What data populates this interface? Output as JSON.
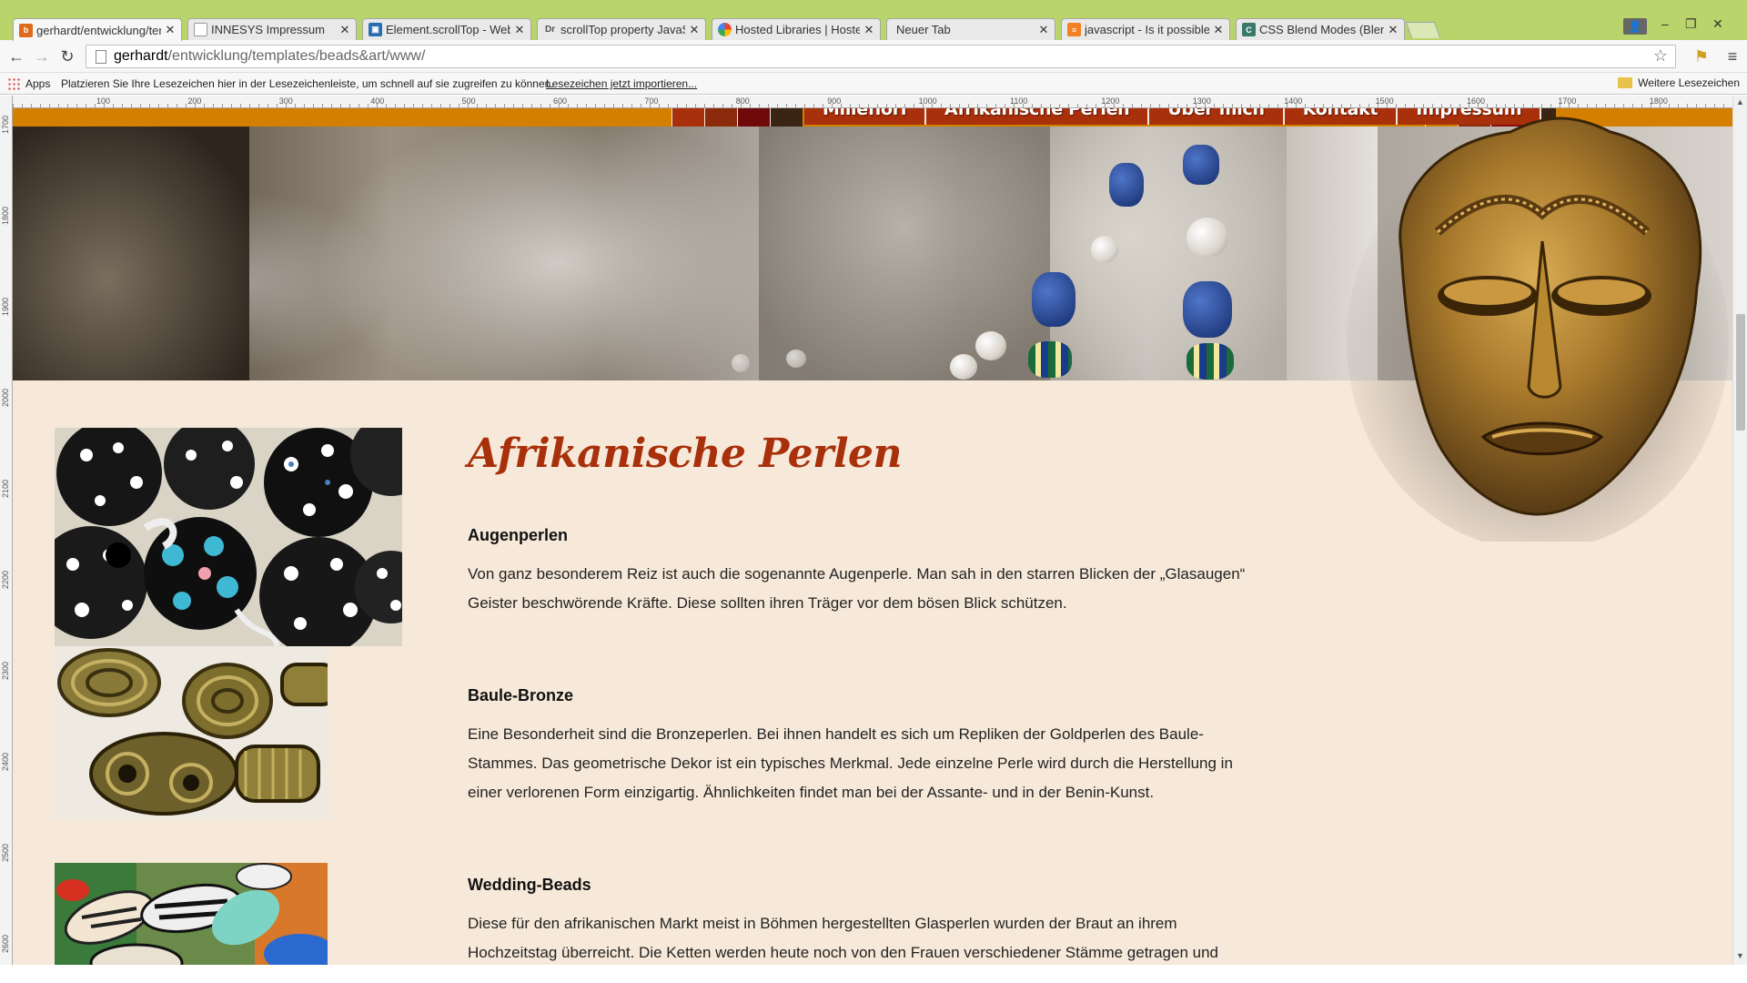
{
  "browser": {
    "tabs": [
      {
        "title": "gerhardt/entwicklung/tem",
        "active": true,
        "favicon": "site-favicon-orange"
      },
      {
        "title": "INNESYS Impressum",
        "favicon": "page-icon"
      },
      {
        "title": "Element.scrollTop - Web A",
        "favicon": "mdn-icon"
      },
      {
        "title": "scrollTop property JavaSc",
        "favicon": "dr-icon"
      },
      {
        "title": "Hosted Libraries  |  Hoste",
        "favicon": "google-icon"
      },
      {
        "title": "Neuer Tab",
        "favicon": "none"
      },
      {
        "title": "javascript - Is it possible to",
        "favicon": "stackoverflow-icon"
      },
      {
        "title": "CSS Blend Modes (Blendi",
        "favicon": "css-icon"
      }
    ],
    "url_host": "gerhardt",
    "url_path": "/entwicklung/templates/beads&art/www/",
    "bookmarks_apps": "Apps",
    "bookmarks_hint": "Platzieren Sie Ihre Lesezeichen hier in der Lesezeichenleiste, um schnell auf sie zugreifen zu können.",
    "bookmarks_import_link": "Lesezeichen jetzt importieren...",
    "bookmarks_more": "Weitere Lesezeichen"
  },
  "ruler": {
    "top_ticks": [
      "100",
      "200",
      "300",
      "400",
      "500",
      "600",
      "700",
      "800",
      "900",
      "1000",
      "1100",
      "1200",
      "1300",
      "1400",
      "1500",
      "1600",
      "1700",
      "1800",
      "190"
    ],
    "left_ticks": [
      "1700",
      "1800",
      "1900",
      "2000",
      "2100",
      "2200",
      "2300",
      "2400",
      "2500",
      "2600"
    ]
  },
  "site": {
    "nav": [
      "Millefiori",
      "Afrikanische Perlen",
      "Über mich",
      "Kontakt",
      "Impressum"
    ],
    "band_colors": [
      "#a8300b",
      "#8c2a0c",
      "#6e0a0a",
      "#3a2414",
      "#d47f00",
      "#8c2a0c",
      "#8b0a14",
      "#3a2414"
    ],
    "title": "Afrikanische Perlen",
    "sections": [
      {
        "heading": "Augenperlen",
        "text": "Von ganz besonderem Reiz ist auch die sogenannte Augenperle. Man sah in den starren Blicken der „Glasaugen“ Geister beschwörende Kräfte. Diese sollten ihren Träger vor dem bösen Blick schützen."
      },
      {
        "heading": "Baule-Bronze",
        "text": "Eine Besonderheit sind die Bronzeperlen. Bei ihnen handelt es sich um Repliken der Goldperlen des Baule-Stammes. Das geometrische Dekor ist ein typisches Merkmal. Jede einzelne Perle wird durch die Herstellung in einer verlorenen Form einzigartig. Ähnlichkeiten findet man bei der Assante- und in der Benin-Kunst."
      },
      {
        "heading": "Wedding-Beads",
        "text": "Diese für den afrikanischen Markt meist in Böhmen hergestellten Glasperlen wurden der Braut an ihrem Hochzeitstag überreicht. Die Ketten werden heute noch von den Frauen verschiedener Stämme getragen und"
      }
    ]
  }
}
